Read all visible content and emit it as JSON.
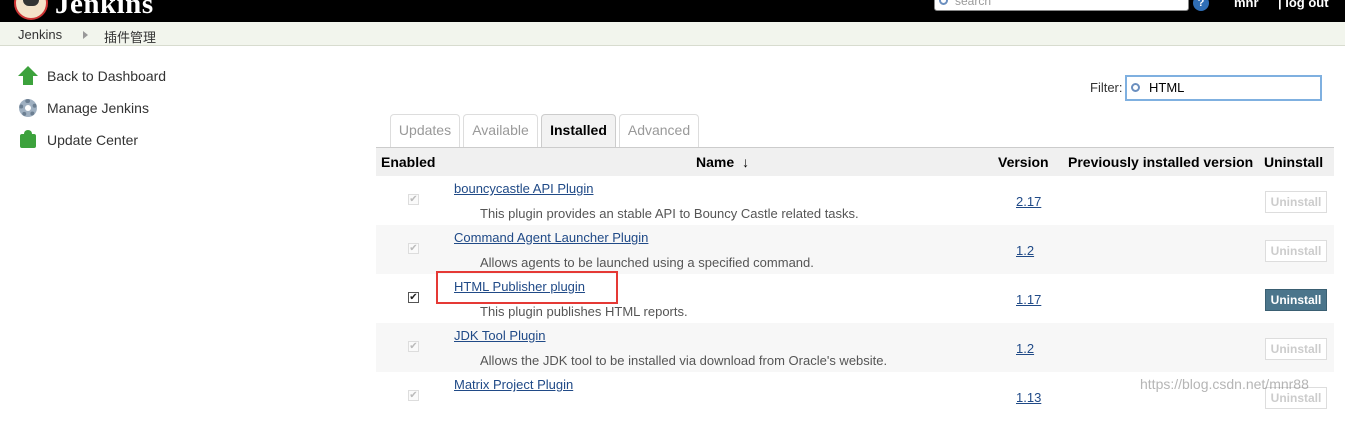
{
  "header": {
    "logo_text": "Jenkins",
    "search_placeholder": "search",
    "help_label": "?",
    "user": "mnr",
    "logout": "| log out"
  },
  "breadcrumb": {
    "items": [
      "Jenkins",
      "插件管理"
    ]
  },
  "sidebar": {
    "items": [
      {
        "label": "Back to Dashboard",
        "icon": "arrow-up-icon"
      },
      {
        "label": "Manage Jenkins",
        "icon": "gear-icon"
      },
      {
        "label": "Update Center",
        "icon": "puzzle-icon"
      }
    ]
  },
  "filter": {
    "label": "Filter:",
    "value": "HTML"
  },
  "tabs": [
    {
      "label": "Updates",
      "active": false
    },
    {
      "label": "Available",
      "active": false
    },
    {
      "label": "Installed",
      "active": true
    },
    {
      "label": "Advanced",
      "active": false
    }
  ],
  "table": {
    "columns": {
      "enabled": "Enabled",
      "name": "Name",
      "sort": "↓",
      "version": "Version",
      "previous": "Previously installed version",
      "uninstall": "Uninstall"
    },
    "rows": [
      {
        "name": "bouncycastle API Plugin",
        "description": "This plugin provides an stable API to Bouncy Castle related tasks.",
        "version": "2.17",
        "enabled": true,
        "editable": false,
        "uninstall": "Uninstall",
        "uninstall_enabled": false
      },
      {
        "name": "Command Agent Launcher Plugin",
        "description": "Allows agents to be launched using a specified command.",
        "version": "1.2",
        "enabled": true,
        "editable": false,
        "uninstall": "Uninstall",
        "uninstall_enabled": false
      },
      {
        "name": "HTML Publisher plugin",
        "description": "This plugin publishes HTML reports.",
        "version": "1.17",
        "enabled": true,
        "editable": true,
        "uninstall": "Uninstall",
        "uninstall_enabled": true
      },
      {
        "name": "JDK Tool Plugin",
        "description": "Allows the JDK tool to be installed via download from Oracle's website.",
        "version": "1.2",
        "enabled": true,
        "editable": false,
        "uninstall": "Uninstall",
        "uninstall_enabled": false
      },
      {
        "name": "Matrix Project Plugin",
        "description": "",
        "version": "1.13",
        "enabled": true,
        "editable": false,
        "uninstall": "Uninstall",
        "uninstall_enabled": false
      }
    ]
  },
  "watermark": "https://blog.csdn.net/mnr88"
}
